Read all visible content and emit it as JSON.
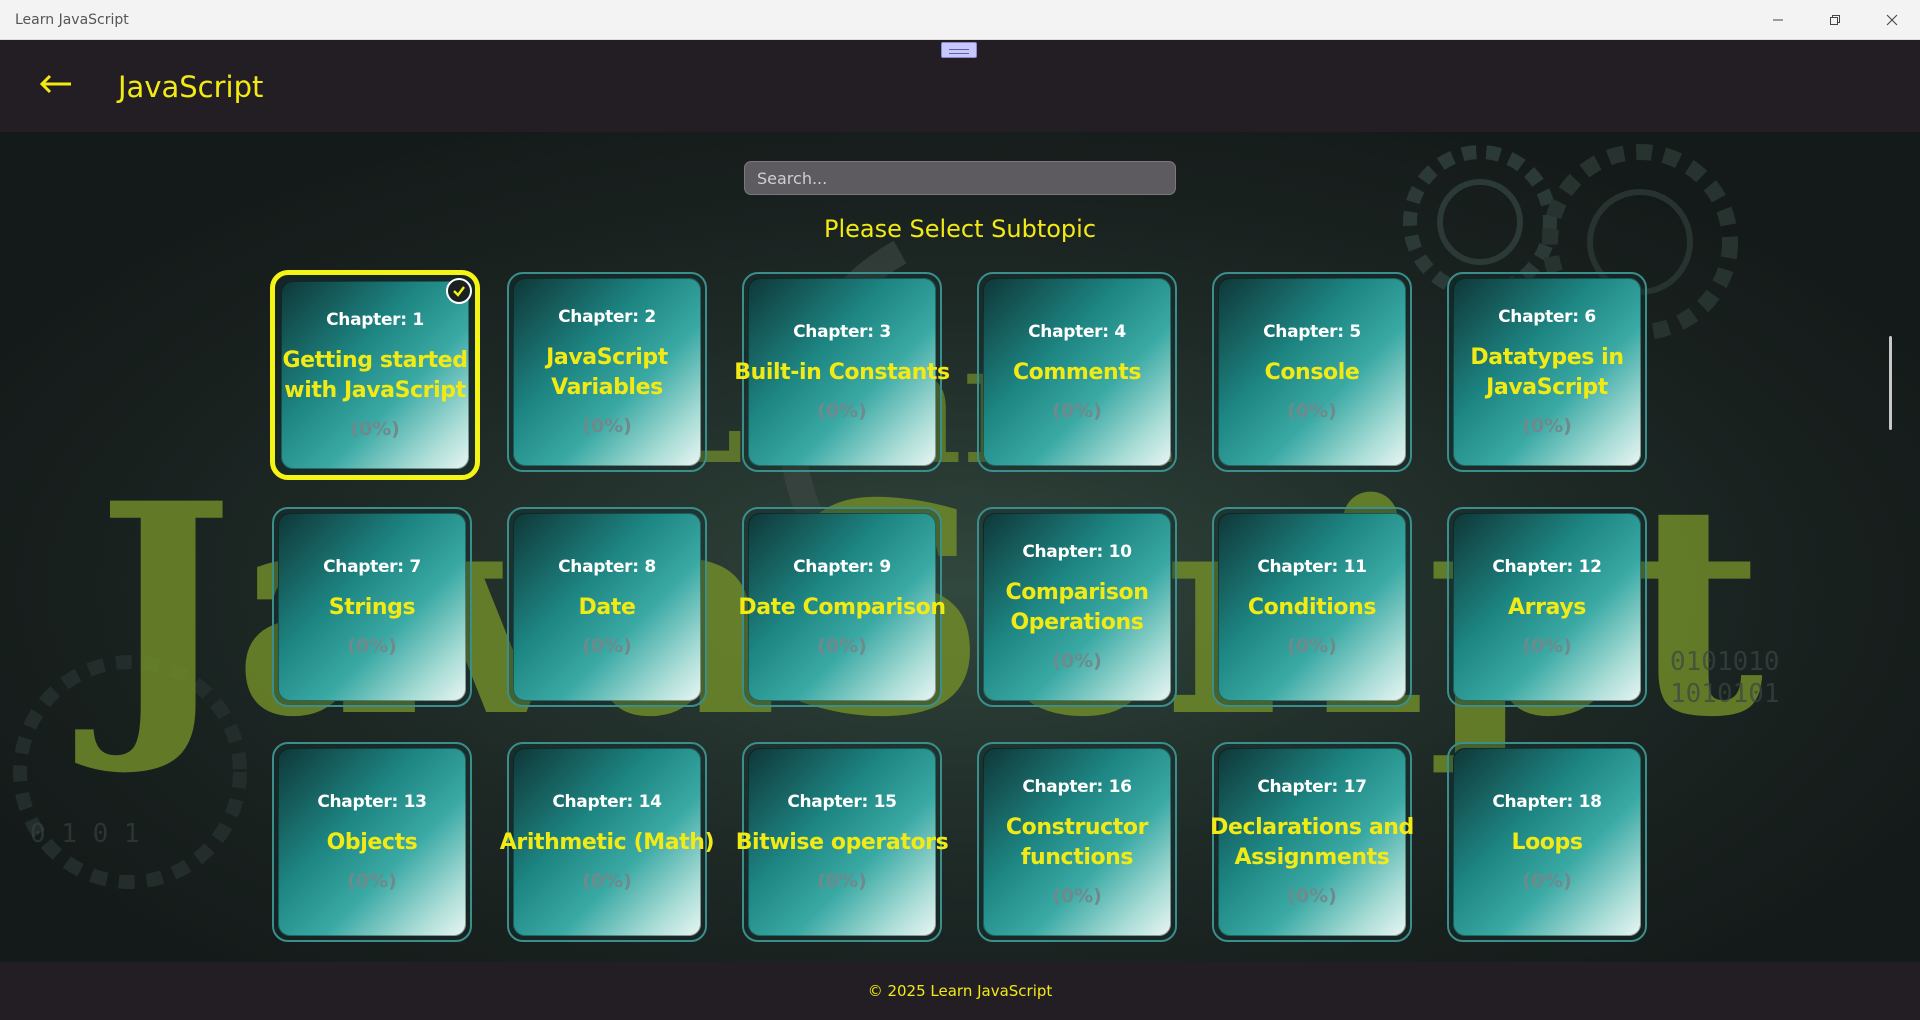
{
  "window": {
    "title": "Learn JavaScript",
    "minimize_icon": "minimize-icon",
    "restore_icon": "restore-icon",
    "close_icon": "close-icon"
  },
  "header": {
    "back_icon": "left-arrow-icon",
    "title": "JavaScript"
  },
  "search": {
    "placeholder": "Search...",
    "value": ""
  },
  "subtitle": "Please Select Subtopic",
  "chapters": [
    {
      "number": "Chapter: 1",
      "title_lines": [
        "Getting started",
        "with JavaScript"
      ],
      "progress": "(0%)",
      "selected": true
    },
    {
      "number": "Chapter: 2",
      "title_lines": [
        "JavaScript",
        "Variables"
      ],
      "progress": "(0%)"
    },
    {
      "number": "Chapter: 3",
      "title_lines": [
        "Built-in Constants"
      ],
      "progress": "(0%)"
    },
    {
      "number": "Chapter: 4",
      "title_lines": [
        "Comments"
      ],
      "progress": "(0%)"
    },
    {
      "number": "Chapter: 5",
      "title_lines": [
        "Console"
      ],
      "progress": "(0%)"
    },
    {
      "number": "Chapter: 6",
      "title_lines": [
        "Datatypes in",
        "JavaScript"
      ],
      "progress": "(0%)"
    },
    {
      "number": "Chapter: 7",
      "title_lines": [
        "Strings"
      ],
      "progress": "(0%)"
    },
    {
      "number": "Chapter: 8",
      "title_lines": [
        "Date"
      ],
      "progress": "(0%)"
    },
    {
      "number": "Chapter: 9",
      "title_lines": [
        "Date Comparison"
      ],
      "progress": "(0%)"
    },
    {
      "number": "Chapter: 10",
      "title_lines": [
        "Comparison",
        "Operations"
      ],
      "progress": "(0%)"
    },
    {
      "number": "Chapter: 11",
      "title_lines": [
        "Conditions"
      ],
      "progress": "(0%)"
    },
    {
      "number": "Chapter: 12",
      "title_lines": [
        "Arrays"
      ],
      "progress": "(0%)"
    },
    {
      "number": "Chapter: 13",
      "title_lines": [
        "Objects"
      ],
      "progress": "(0%)"
    },
    {
      "number": "Chapter: 14",
      "title_lines": [
        "Arithmetic (Math)"
      ],
      "progress": "(0%)"
    },
    {
      "number": "Chapter: 15",
      "title_lines": [
        "Bitwise operators"
      ],
      "progress": "(0%)"
    },
    {
      "number": "Chapter: 16",
      "title_lines": [
        "Constructor",
        "functions"
      ],
      "progress": "(0%)"
    },
    {
      "number": "Chapter: 17",
      "title_lines": [
        "Declarations and",
        "Assignments"
      ],
      "progress": "(0%)"
    },
    {
      "number": "Chapter: 18",
      "title_lines": [
        "Loops"
      ],
      "progress": "(0%)"
    }
  ],
  "selected_icon": "checkmark-icon",
  "footer": {
    "text": "© 2025 Learn JavaScript"
  },
  "colors": {
    "accent_yellow": "#f2ea14",
    "header_bg": "#221e24",
    "card_teal": "#1d8582"
  }
}
